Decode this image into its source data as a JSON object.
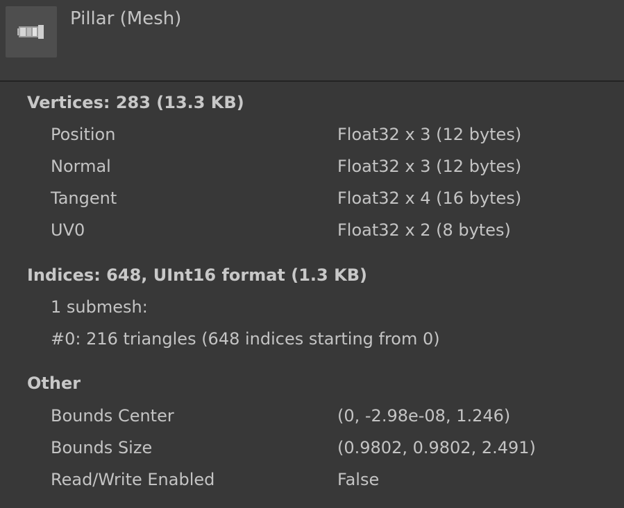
{
  "header": {
    "title": "Pillar (Mesh)",
    "thumbnail_icon": "mesh-preview-icon"
  },
  "vertices": {
    "title": "Vertices: 283 (13.3 KB)",
    "rows": [
      {
        "label": "Position",
        "value": "Float32 x 3 (12 bytes)"
      },
      {
        "label": "Normal",
        "value": "Float32 x 3 (12 bytes)"
      },
      {
        "label": "Tangent",
        "value": "Float32 x 4 (16 bytes)"
      },
      {
        "label": "UV0",
        "value": "Float32 x 2 (8 bytes)"
      }
    ]
  },
  "indices": {
    "title": "Indices: 648, UInt16 format (1.3 KB)",
    "submesh_count": "1 submesh:",
    "submesh_detail": "#0: 216 triangles (648 indices starting from 0)"
  },
  "other": {
    "title": "Other",
    "rows": [
      {
        "label": "Bounds Center",
        "value": "(0, -2.98e-08, 1.246)"
      },
      {
        "label": "Bounds Size",
        "value": "(0.9802, 0.9802, 2.491)"
      },
      {
        "label": "Read/Write Enabled",
        "value": "False"
      }
    ]
  }
}
